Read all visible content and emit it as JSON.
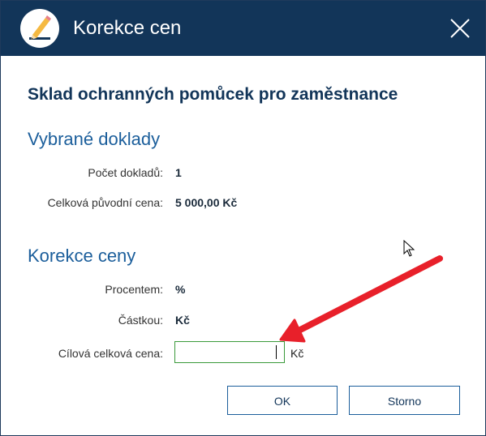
{
  "window": {
    "title": "Korekce cen",
    "app_icon": "pencil-edit-icon",
    "close_icon": "close-icon"
  },
  "heading": "Sklad ochranných pomůcek pro zaměstnance",
  "selected_docs": {
    "title": "Vybrané doklady",
    "count_label": "Počet dokladů:",
    "count_value": "1",
    "original_price_label": "Celková původní cena:",
    "original_price_value": "5 000,00 Kč"
  },
  "correction": {
    "title": "Korekce ceny",
    "percent_label": "Procentem:",
    "percent_unit": "%",
    "amount_label": "Částkou:",
    "amount_unit": "Kč",
    "target_label": "Cílová celková cena:",
    "target_value": "",
    "target_unit": "Kč"
  },
  "buttons": {
    "ok": "OK",
    "cancel": "Storno"
  },
  "colors": {
    "titlebar": "#123559",
    "heading": "#123559",
    "section": "#1b5e9b",
    "input_border": "#3a9a3a",
    "annotation_arrow": "#e8202a"
  }
}
